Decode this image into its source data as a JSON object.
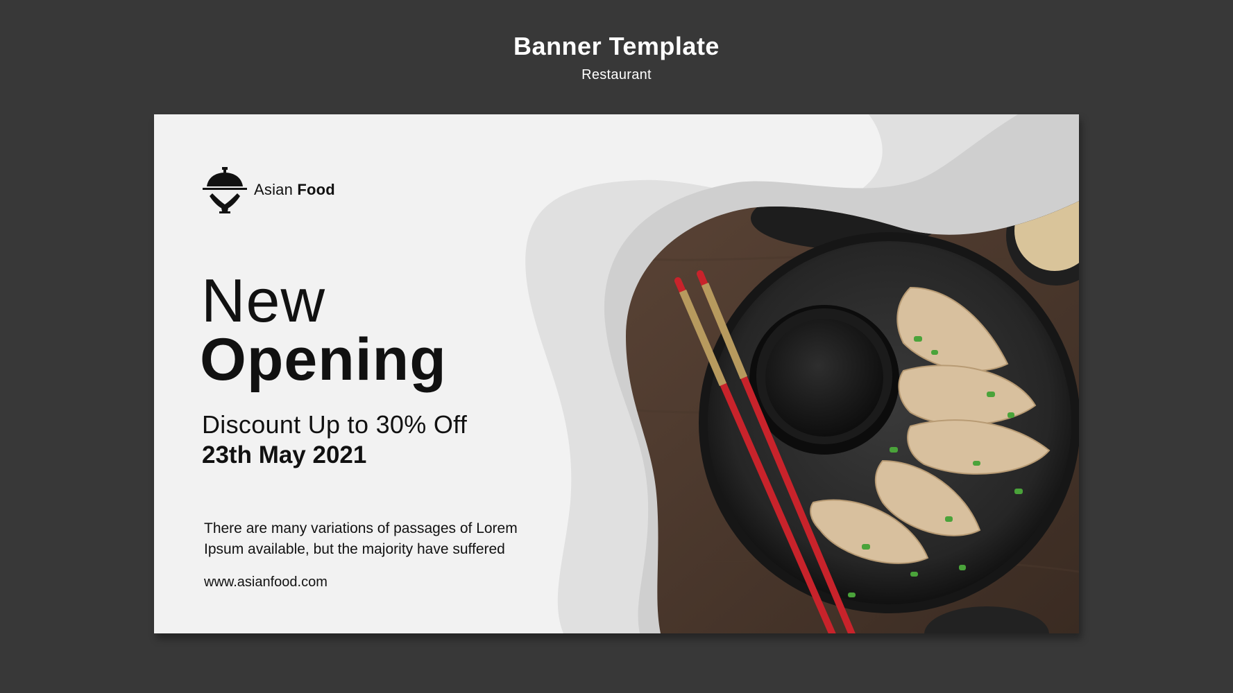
{
  "header": {
    "title": "Banner Template",
    "subtitle": "Restaurant"
  },
  "banner": {
    "logo": {
      "icon": "cloche-icon",
      "text_light": "Asian ",
      "text_bold": "Food"
    },
    "headline_light": "New",
    "headline_bold": "Opening",
    "discount": "Discount Up to 30% Off",
    "date": "23th May 2021",
    "body_line1": "There are many variations of passages of Lorem",
    "body_line2": "Ipsum available, but the majority have suffered",
    "url": "www.asianfood.com",
    "image": "dumplings-plate-photo"
  },
  "colors": {
    "background": "#383838",
    "banner": "#f2f2f2",
    "text": "#111111",
    "chopsticks": "#c8232b"
  }
}
